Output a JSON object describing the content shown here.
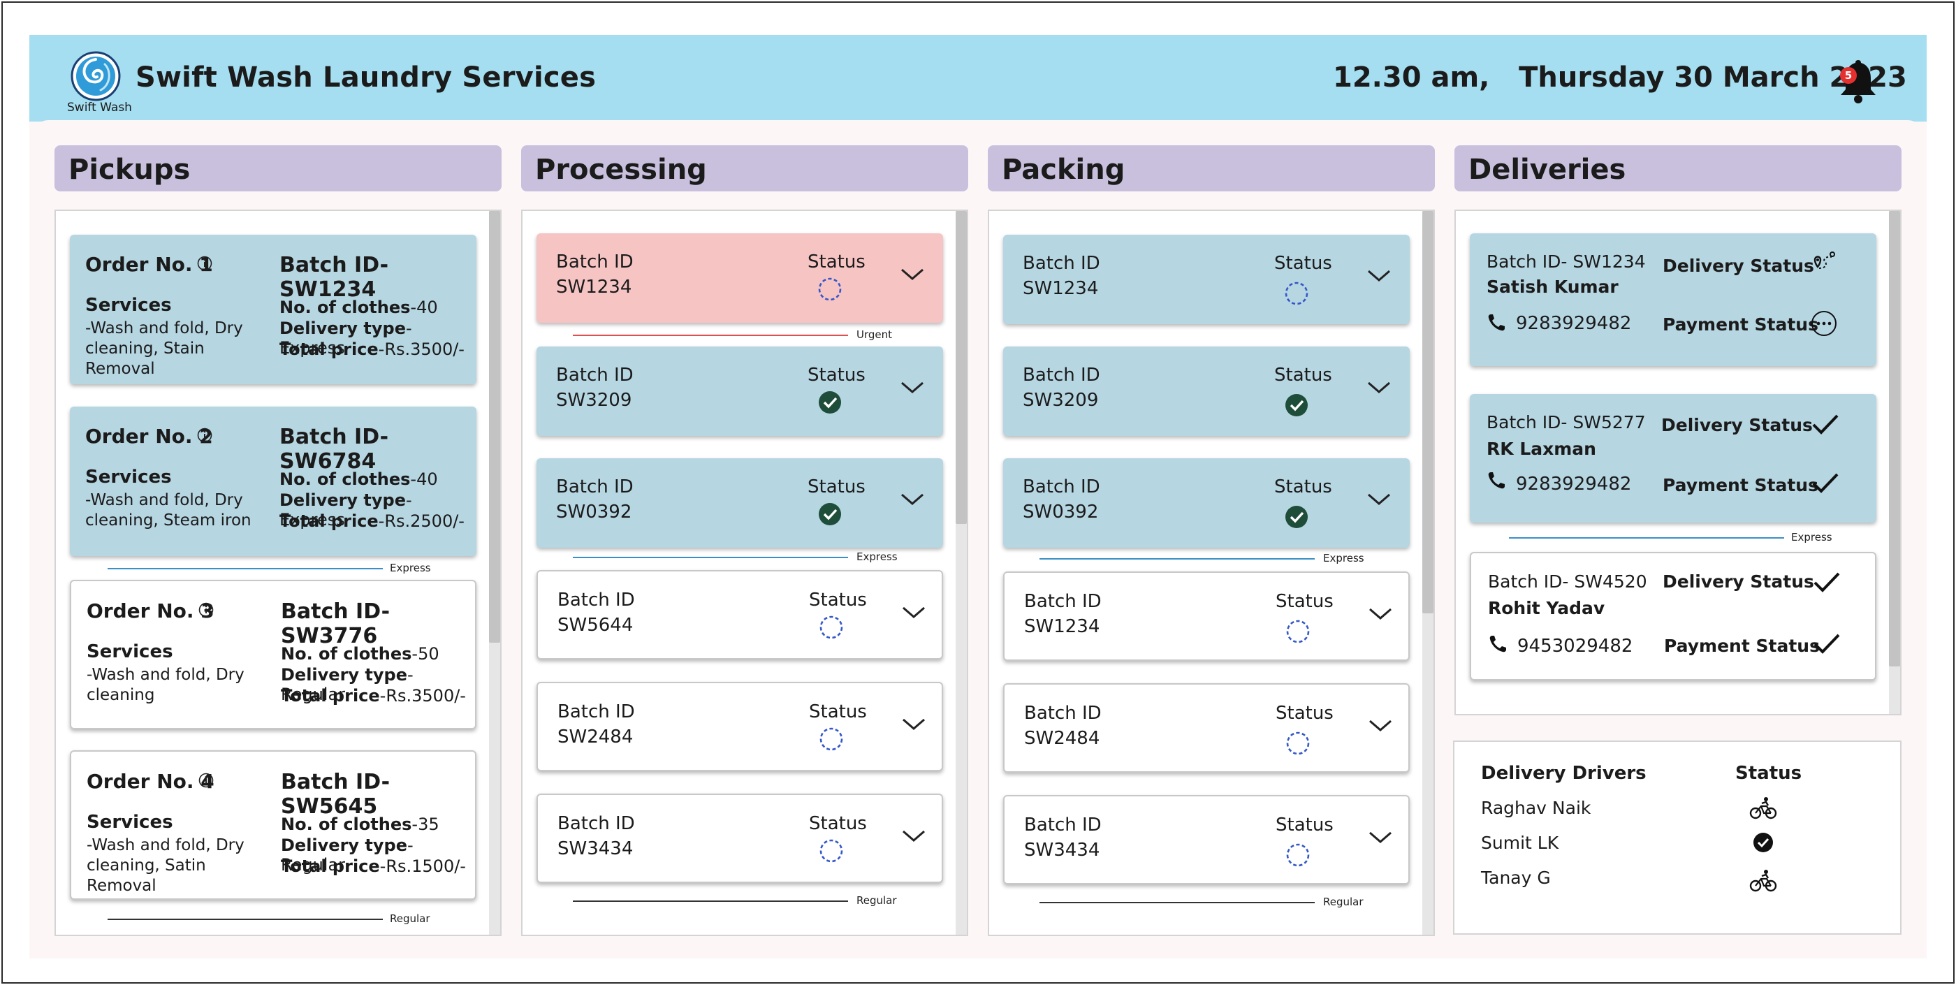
{
  "app": {
    "logo_text": "Swift Wash",
    "title": "Swift Wash Laundry Services",
    "datetime": "12.30 am,   Thursday 30 March 2023",
    "notification_count": "5"
  },
  "columns": {
    "pickups": "Pickups",
    "processing": "Processing",
    "packing": "Packing",
    "deliveries": "Deliveries"
  },
  "labels": {
    "services": "Services",
    "no_of_clothes": "No. of clothes",
    "delivery_type": "Delivery type",
    "total_price": "Total price",
    "batch_id": "Batch ID",
    "status": "Status",
    "delivery_status": "Delivery Status",
    "payment_status": "Payment Status",
    "urgent": "Urgent",
    "express": "Express",
    "regular": "Regular"
  },
  "pickups": [
    {
      "order": "Order No. 1",
      "batch": "Batch ID- SW1234",
      "services": "-Wash and fold, Dry cleaning, Stain Removal",
      "clothes": "-40",
      "type": "-Express",
      "price": "-Rs.3500/-"
    },
    {
      "order": "Order No. 2",
      "batch": "Batch ID- SW6784",
      "services": "-Wash and fold, Dry cleaning, Steam iron",
      "clothes": "-40",
      "type": "-Express",
      "price": "-Rs.2500/-"
    },
    {
      "order": "Order No. 3",
      "batch": "Batch ID- SW3776",
      "services": "-Wash and fold, Dry cleaning",
      "clothes": "-50",
      "type": "-Regular",
      "price": "-Rs.3500/-"
    },
    {
      "order": "Order No. 4",
      "batch": "Batch ID- SW5645",
      "services": "-Wash and fold, Dry cleaning, Satin Removal",
      "clothes": "-35",
      "type": "-Regular",
      "price": "-Rs.1500/-"
    }
  ],
  "processing": [
    {
      "id": "SW1234",
      "status": "in-progress"
    },
    {
      "id": "SW3209",
      "status": "done"
    },
    {
      "id": "SW0392",
      "status": "done"
    },
    {
      "id": "SW5644",
      "status": "in-progress"
    },
    {
      "id": "SW2484",
      "status": "in-progress"
    },
    {
      "id": "SW3434",
      "status": "in-progress"
    }
  ],
  "packing": [
    {
      "id": "SW1234",
      "status": "in-progress"
    },
    {
      "id": "SW3209",
      "status": "done"
    },
    {
      "id": "SW0392",
      "status": "done"
    },
    {
      "id": "SW1234",
      "status": "in-progress"
    },
    {
      "id": "SW2484",
      "status": "in-progress"
    },
    {
      "id": "SW3434",
      "status": "in-progress"
    }
  ],
  "deliveries": [
    {
      "batch": "Batch ID- SW1234",
      "name": "Satish Kumar",
      "phone": "9283929482",
      "delivery_status": "route-icon",
      "payment_status": "pending-icon"
    },
    {
      "batch": "Batch ID- SW5277",
      "name": "RK Laxman",
      "phone": "9283929482",
      "delivery_status": "check-icon",
      "payment_status": "check-icon"
    },
    {
      "batch": "Batch ID- SW4520",
      "name": "Rohit Yadav",
      "phone": "9453029482",
      "delivery_status": "check-icon",
      "payment_status": "check-icon"
    }
  ],
  "drivers": {
    "header_name": "Delivery Drivers",
    "header_status": "Status",
    "list": [
      {
        "name": "Raghav Naik",
        "status": "cycling-icon"
      },
      {
        "name": "Sumit LK",
        "status": "check-circle-icon"
      },
      {
        "name": "Tanay G",
        "status": "cycling-icon"
      }
    ]
  },
  "colors": {
    "header": "#a5def0",
    "column_title": "#c9c0de",
    "card_blue": "#b6d6e2",
    "card_urgent": "#f7c4c4",
    "urgent_line": "#e15050",
    "express_line": "#3b8fc7",
    "done": "#1e4d3a",
    "pending_spinner": "#3557c7"
  }
}
